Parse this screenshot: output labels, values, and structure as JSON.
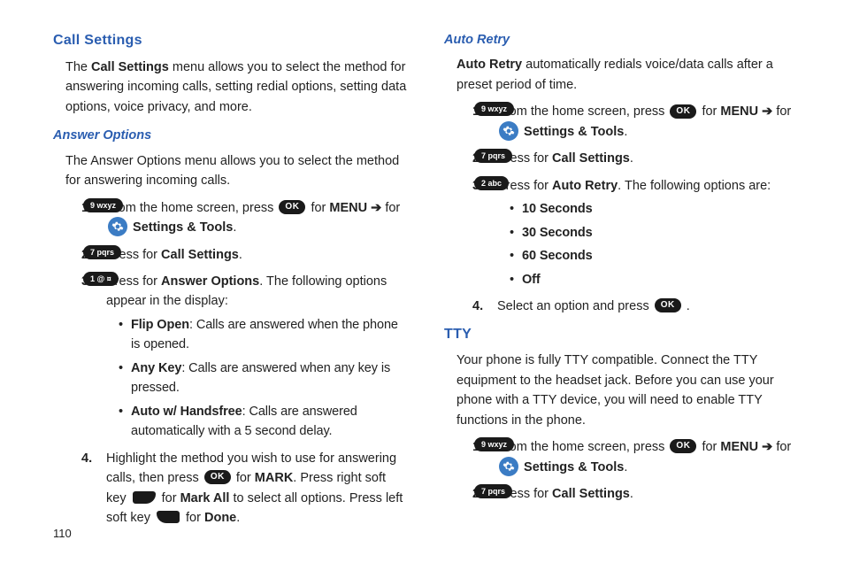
{
  "pageNumber": "110",
  "left": {
    "h2": "Call Settings",
    "intro_pre": "The ",
    "intro_b": "Call Settings",
    "intro_post": " menu allows you to select the method for answering incoming calls, setting redial options, setting data options, voice privacy, and more.",
    "h3": "Answer Options",
    "ans_intro": "The Answer Options menu allows you to select the method for answering incoming calls.",
    "s1_a": "From the home screen, press ",
    "s1_b": " for ",
    "s1_menu": "MENU",
    "s1_arrow": "  ➔  ",
    "s1_c": " for ",
    "s1_tools": "Settings & Tools",
    "s2_a": "Press ",
    "s2_b": " for ",
    "s2_cs": "Call Settings",
    "s3_a": "Press ",
    "s3_b": " for ",
    "s3_ao": "Answer Options",
    "s3_c": ". The following options appear in the display:",
    "opt1_b": "Flip Open",
    "opt1_t": ": Calls are answered when the phone is opened.",
    "opt2_b": "Any Key",
    "opt2_t": ": Calls are answered when any key is pressed.",
    "opt3_b": "Auto w/ Handsfree",
    "opt3_t": ": Calls are answered automatically with a 5 second delay.",
    "s4_a": "Highlight the method you wish to use for answering calls, then press ",
    "s4_b": " for ",
    "s4_mark": "MARK",
    "s4_c": ". Press right soft key ",
    "s4_d": " for ",
    "s4_ma": "Mark All",
    "s4_e": " to select all options. Press left soft key ",
    "s4_f": " for ",
    "s4_done": "Done",
    "n1": "1.",
    "n2": "2.",
    "n3": "3.",
    "n4": "4."
  },
  "right": {
    "h3a": "Auto Retry",
    "ar_b": "Auto Retry",
    "ar_t": " automatically redials voice/data calls after a preset period of time.",
    "s1_a": "From the home screen, press ",
    "s1_b": " for ",
    "s1_menu": "MENU",
    "s1_arrow": "  ➔  ",
    "s1_c": " for ",
    "s1_tools": "Settings & Tools",
    "s2_a": "Press ",
    "s2_b": " for ",
    "s2_cs": "Call Settings",
    "s3_a": "Press ",
    "s3_b": " for ",
    "s3_ar": "Auto Retry",
    "s3_c": ". The following options are:",
    "opt1": "10 Seconds",
    "opt2": "30 Seconds",
    "opt3": "60 Seconds",
    "opt4": "Off",
    "s4_a": "Select an option and press ",
    "h2": "TTY",
    "tty_intro": "Your phone is fully TTY compatible. Connect the TTY equipment to the headset jack. Before you can use your phone with a TTY device, you will need to enable TTY functions in the phone.",
    "t1_a": "From the home screen, press ",
    "t1_b": " for ",
    "t1_menu": "MENU",
    "t1_arrow": "  ➔  ",
    "t1_c": " for ",
    "t1_tools": "Settings & Tools",
    "t2_a": "Press ",
    "t2_b": " for ",
    "t2_cs": "Call Settings",
    "n1": "1.",
    "n2": "2.",
    "n3": "3.",
    "n4": "4."
  },
  "keys": {
    "ok": "OK",
    "nine": "9 wxyz",
    "seven": "7 pqrs",
    "one": "1   @ ¤",
    "two": "2 abc"
  }
}
